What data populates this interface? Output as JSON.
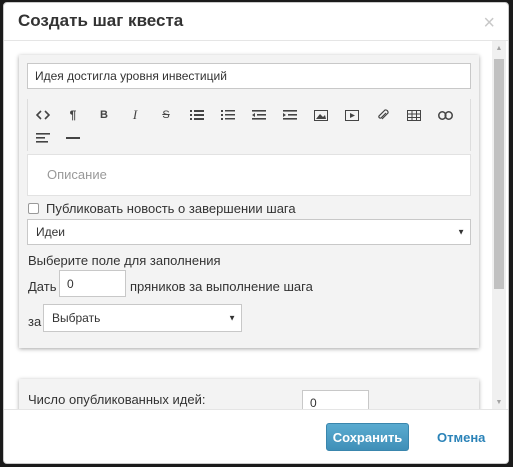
{
  "modal": {
    "title": "Создать шаг квеста",
    "close_glyph": "×"
  },
  "step": {
    "title_value": "Идея достигла уровня инвестиций",
    "description_placeholder": "Описание",
    "publish_news_label": "Публиковать новость о завершении шага",
    "publish_news_checked": false,
    "category_selected": "Идеи",
    "field_prompt": "Выберите поле для заполнения",
    "reward_prefix": "Дать",
    "reward_value": "0",
    "reward_suffix": "пряников за выполнение шага",
    "for_label": "за",
    "for_selected": "Выбрать"
  },
  "toolbar": {
    "buttons": [
      {
        "icon": "code-view-icon",
        "glyph": "<>"
      },
      {
        "icon": "paragraph-icon",
        "glyph": "¶"
      },
      {
        "icon": "bold-icon",
        "glyph": "B"
      },
      {
        "icon": "italic-icon",
        "glyph": "I"
      },
      {
        "icon": "strikethrough-icon",
        "glyph": "S"
      },
      {
        "icon": "unordered-list-icon",
        "glyph": ""
      },
      {
        "icon": "ordered-list-icon",
        "glyph": ""
      },
      {
        "icon": "outdent-icon",
        "glyph": ""
      },
      {
        "icon": "indent-icon",
        "glyph": ""
      },
      {
        "icon": "image-icon",
        "glyph": ""
      },
      {
        "icon": "video-icon",
        "glyph": ""
      },
      {
        "icon": "file-attach-icon",
        "glyph": ""
      },
      {
        "icon": "table-icon",
        "glyph": ""
      },
      {
        "icon": "link-icon",
        "glyph": ""
      },
      {
        "icon": "align-icon",
        "glyph": ""
      },
      {
        "icon": "horizontal-rule-icon",
        "glyph": ""
      }
    ]
  },
  "condition": {
    "label": "Число опубликованных идей:",
    "value": "0"
  },
  "footer": {
    "save_label": "Сохранить",
    "cancel_label": "Отмена"
  },
  "colors": {
    "primary": "#3f8fb8",
    "link": "#2b83b8"
  }
}
